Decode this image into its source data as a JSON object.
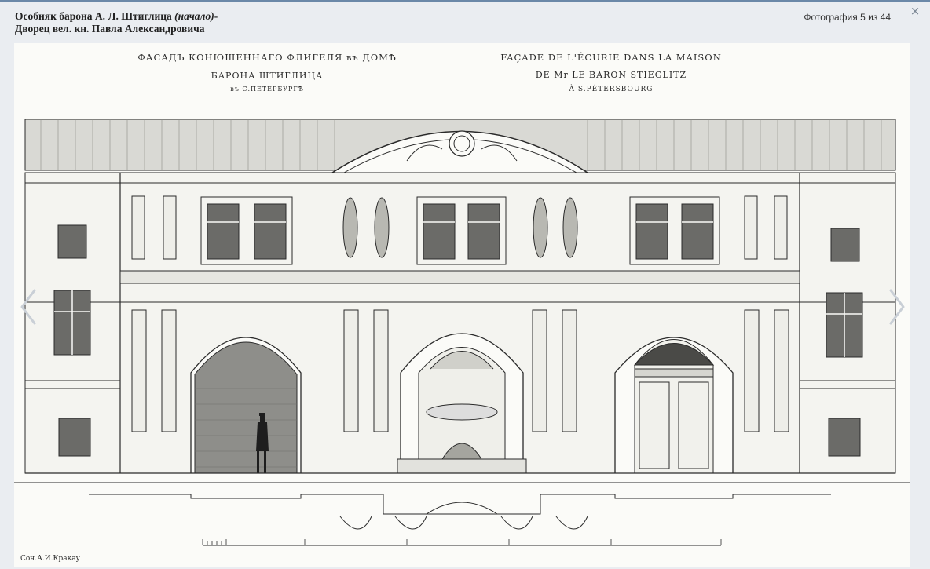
{
  "viewer": {
    "title_line1": "Особняк барона А. Л. Штиглица ",
    "title_italic": "(начало)",
    "title_dash": "-",
    "title_line2": "Дворец вел. кн. Павла Александровича",
    "counter": "Фотография 5 из 44",
    "close_glyph": "×",
    "prev_icon": "chevron-left-icon",
    "next_icon": "chevron-right-icon"
  },
  "engraving": {
    "russian_caption_1": "ФАСАДЪ КОНЮШЕННАГО ФЛИГЕЛЯ въ ДОМѢ",
    "russian_caption_2": "БАРОНА ШТИГЛИЦА",
    "russian_caption_3": "въ С.ПЕТЕРБУРГѢ",
    "french_caption_1": "FAÇADE DE L'ÉCURIE DANS LA MAISON",
    "french_caption_2": "DE Mr LE BARON STIEGLITZ",
    "french_caption_3": "À S.PÉTERSBOURG",
    "signature": "Соч.А.И.Кракау"
  },
  "colors": {
    "ink": "#2a2a2a",
    "paper": "#fbfbf8",
    "background": "#eaedf1",
    "top_bar": "#6b88a8"
  }
}
